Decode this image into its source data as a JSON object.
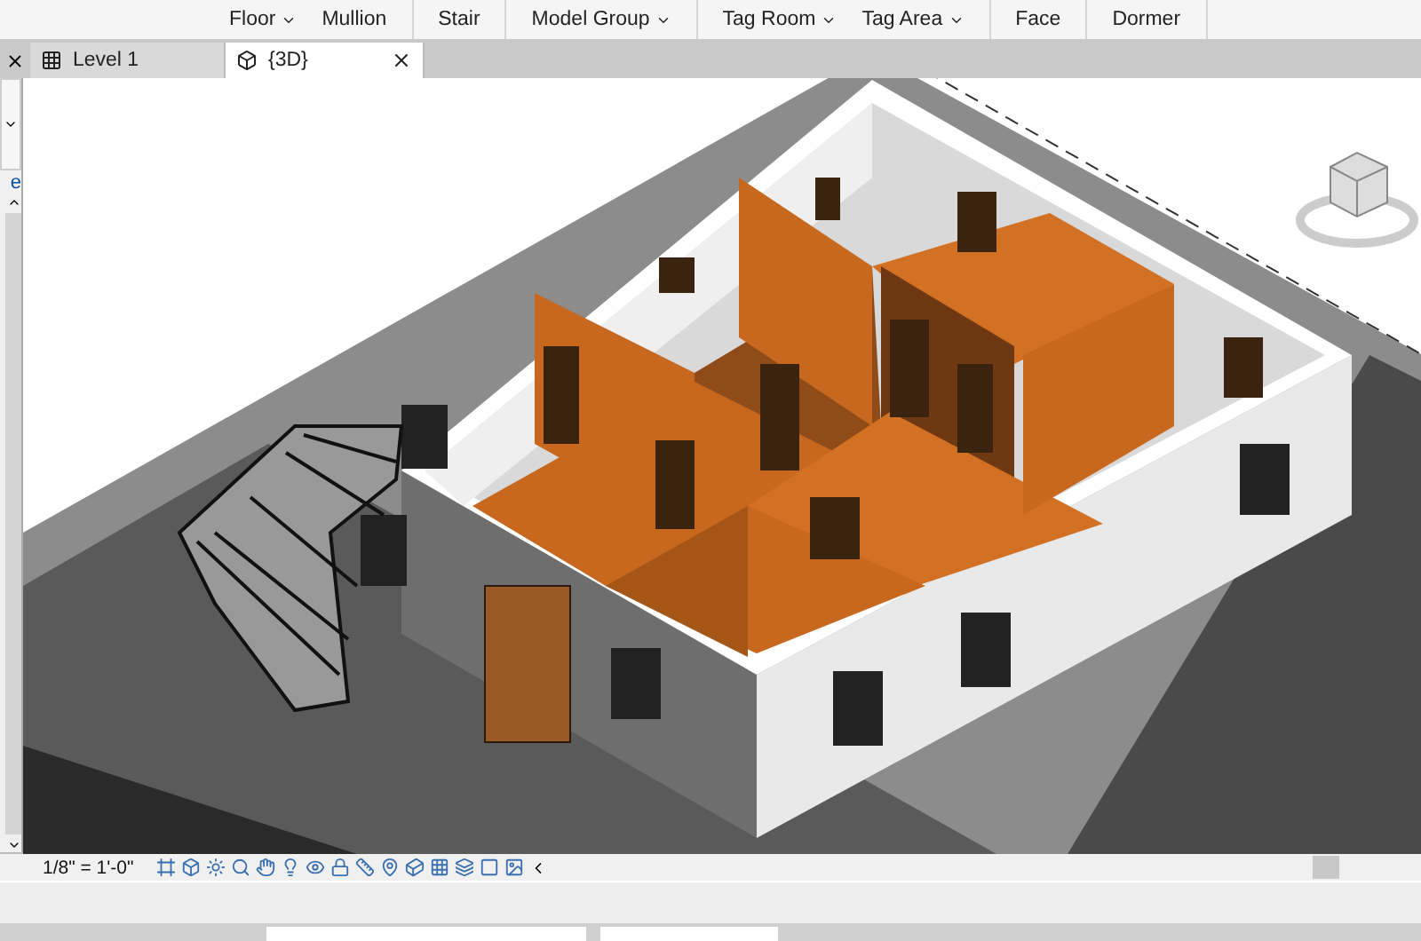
{
  "ribbon": {
    "panels": [
      {
        "items": [
          {
            "label": "Floor",
            "dropdown": true
          },
          {
            "label": "Mullion",
            "dropdown": false
          }
        ]
      },
      {
        "items": [
          {
            "label": "Stair",
            "dropdown": false
          }
        ]
      },
      {
        "items": [
          {
            "label": "Model Group",
            "dropdown": true
          }
        ]
      },
      {
        "items": [
          {
            "label": "Tag Room",
            "dropdown": true
          },
          {
            "label": "Tag Area",
            "dropdown": true
          }
        ]
      },
      {
        "items": [
          {
            "label": "Face",
            "dropdown": false
          }
        ]
      },
      {
        "items": [
          {
            "label": "Dormer",
            "dropdown": false
          }
        ]
      }
    ]
  },
  "tabs": [
    {
      "label": "Level 1",
      "selected": false
    },
    {
      "label": "{3D}",
      "selected": true
    }
  ],
  "properties_panel": {
    "label": "e"
  },
  "view_bar": {
    "scale": "1/8\" = 1'-0\""
  }
}
